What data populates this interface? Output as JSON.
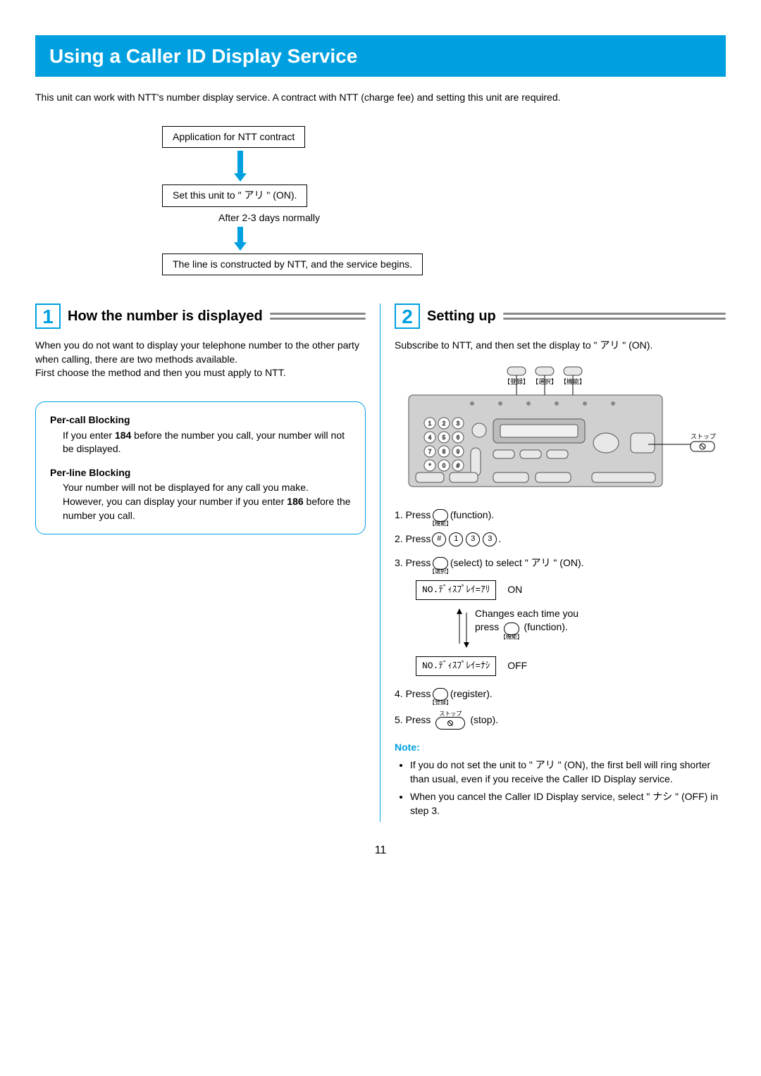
{
  "titleBar": "Using a Caller ID Display Service",
  "intro": "This unit can work with NTT's number display service. A contract with NTT (charge fee) and setting this unit are required.",
  "flow": {
    "box1": "Application for NTT contract",
    "box2": "Set this unit to \" アリ \" (ON).",
    "note": "After 2-3 days normally",
    "box3": "The line is constructed by NTT, and the service begins."
  },
  "section1": {
    "num": "1",
    "title": "How the number is displayed",
    "p1": "When you do not want to display your telephone number to the other party when calling, there are two methods available.",
    "p2": "First choose the method and then you must apply to NTT.",
    "perCallTitle": "Per-call Blocking",
    "perCallBody_a": "If you enter ",
    "perCallBody_bold": "184",
    "perCallBody_b": " before the number you call, your number will not be displayed.",
    "perLineTitle": "Per-line Blocking",
    "perLineBody_a": "Your number will not be displayed for any call you make. However, you can display your number if you enter ",
    "perLineBody_bold": "186",
    "perLineBody_b": " before the number you call."
  },
  "section2": {
    "num": "2",
    "title": "Setting up",
    "intro": "Subscribe to NTT, and then set the display to \" アリ \" (ON).",
    "deviceLabels": {
      "reg": "【登録】",
      "sel": "【選択】",
      "func": "【機能】",
      "stop": "ストップ"
    },
    "step1_a": "1. Press ",
    "step1_btn_sub": "【機能】",
    "step1_b": " (function).",
    "step2_a": "2. Press ",
    "step2_k1": "#",
    "step2_k2": "1",
    "step2_k3": "3",
    "step2_k4": "3",
    "step2_b": " .",
    "step3_a": "3. Press ",
    "step3_btn_sub": "【選択】",
    "step3_b": " (select) to select \" アリ \" (ON).",
    "lcdOn": "NO.ﾃﾞｨｽﾌﾟﾚｲ=ｱﾘ",
    "lcdOnLabel": "ON",
    "changeNote_a": "Changes each time you",
    "changeNote_b": "press ",
    "changeNote_btn_sub": "【機能】",
    "changeNote_c": " (function).",
    "lcdOff": "NO.ﾃﾞｨｽﾌﾟﾚｲ=ﾅｼ",
    "lcdOffLabel": "OFF",
    "step4_a": "4. Press ",
    "step4_btn_sub": "【登録】",
    "step4_b": " (register).",
    "step5_a": "5. Press ",
    "step5_btn_top": "ストップ",
    "step5_b": " (stop).",
    "noteHead": "Note:",
    "note1": "If you do not set the unit to \" アリ \" (ON), the first bell will ring shorter than usual, even if you receive the Caller ID Display service.",
    "note2": "When you cancel the Caller ID Display service, select \" ナシ \" (OFF) in step 3."
  },
  "pageNumber": "11"
}
